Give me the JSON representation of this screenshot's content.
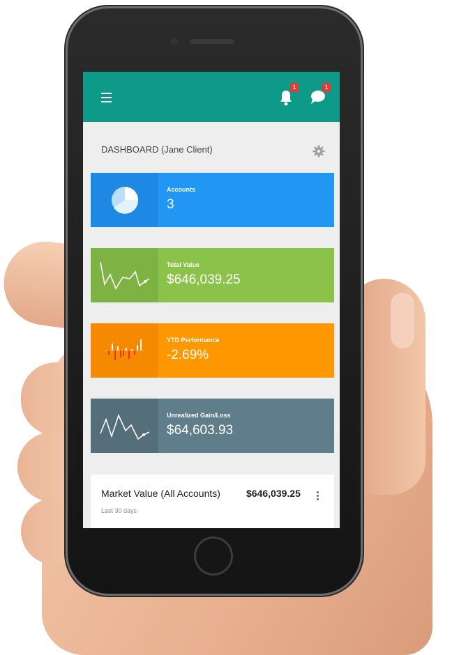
{
  "appbar": {
    "menu_icon": "hamburger-menu-icon",
    "notifications": {
      "icon": "bell-icon",
      "badge": "1"
    },
    "messages": {
      "icon": "chat-bubble-icon",
      "badge": "1"
    },
    "color": "#0d9a88"
  },
  "dashboard": {
    "title": "DASHBOARD (Jane Client)",
    "settings_icon": "gear-icon"
  },
  "cards": [
    {
      "icon": "pie-chart-icon",
      "label": "Accounts",
      "value": "3",
      "color": "#2196f3"
    },
    {
      "icon": "line-chart-icon",
      "label": "Total Value",
      "value": "$646,039.25",
      "color": "#8bc34a"
    },
    {
      "icon": "bar-chart-icon",
      "label": "YTD Performance",
      "value": "-2.69%",
      "color": "#ff9800"
    },
    {
      "icon": "line-chart-icon",
      "label": "Unrealized Gain/Loss",
      "value": "$64,603.93",
      "color": "#607d8b"
    }
  ],
  "market_value": {
    "title": "Market Value (All Accounts)",
    "value": "$646,039.25",
    "subtitle": "Last 30 days",
    "menu_icon": "more-vert-icon"
  }
}
